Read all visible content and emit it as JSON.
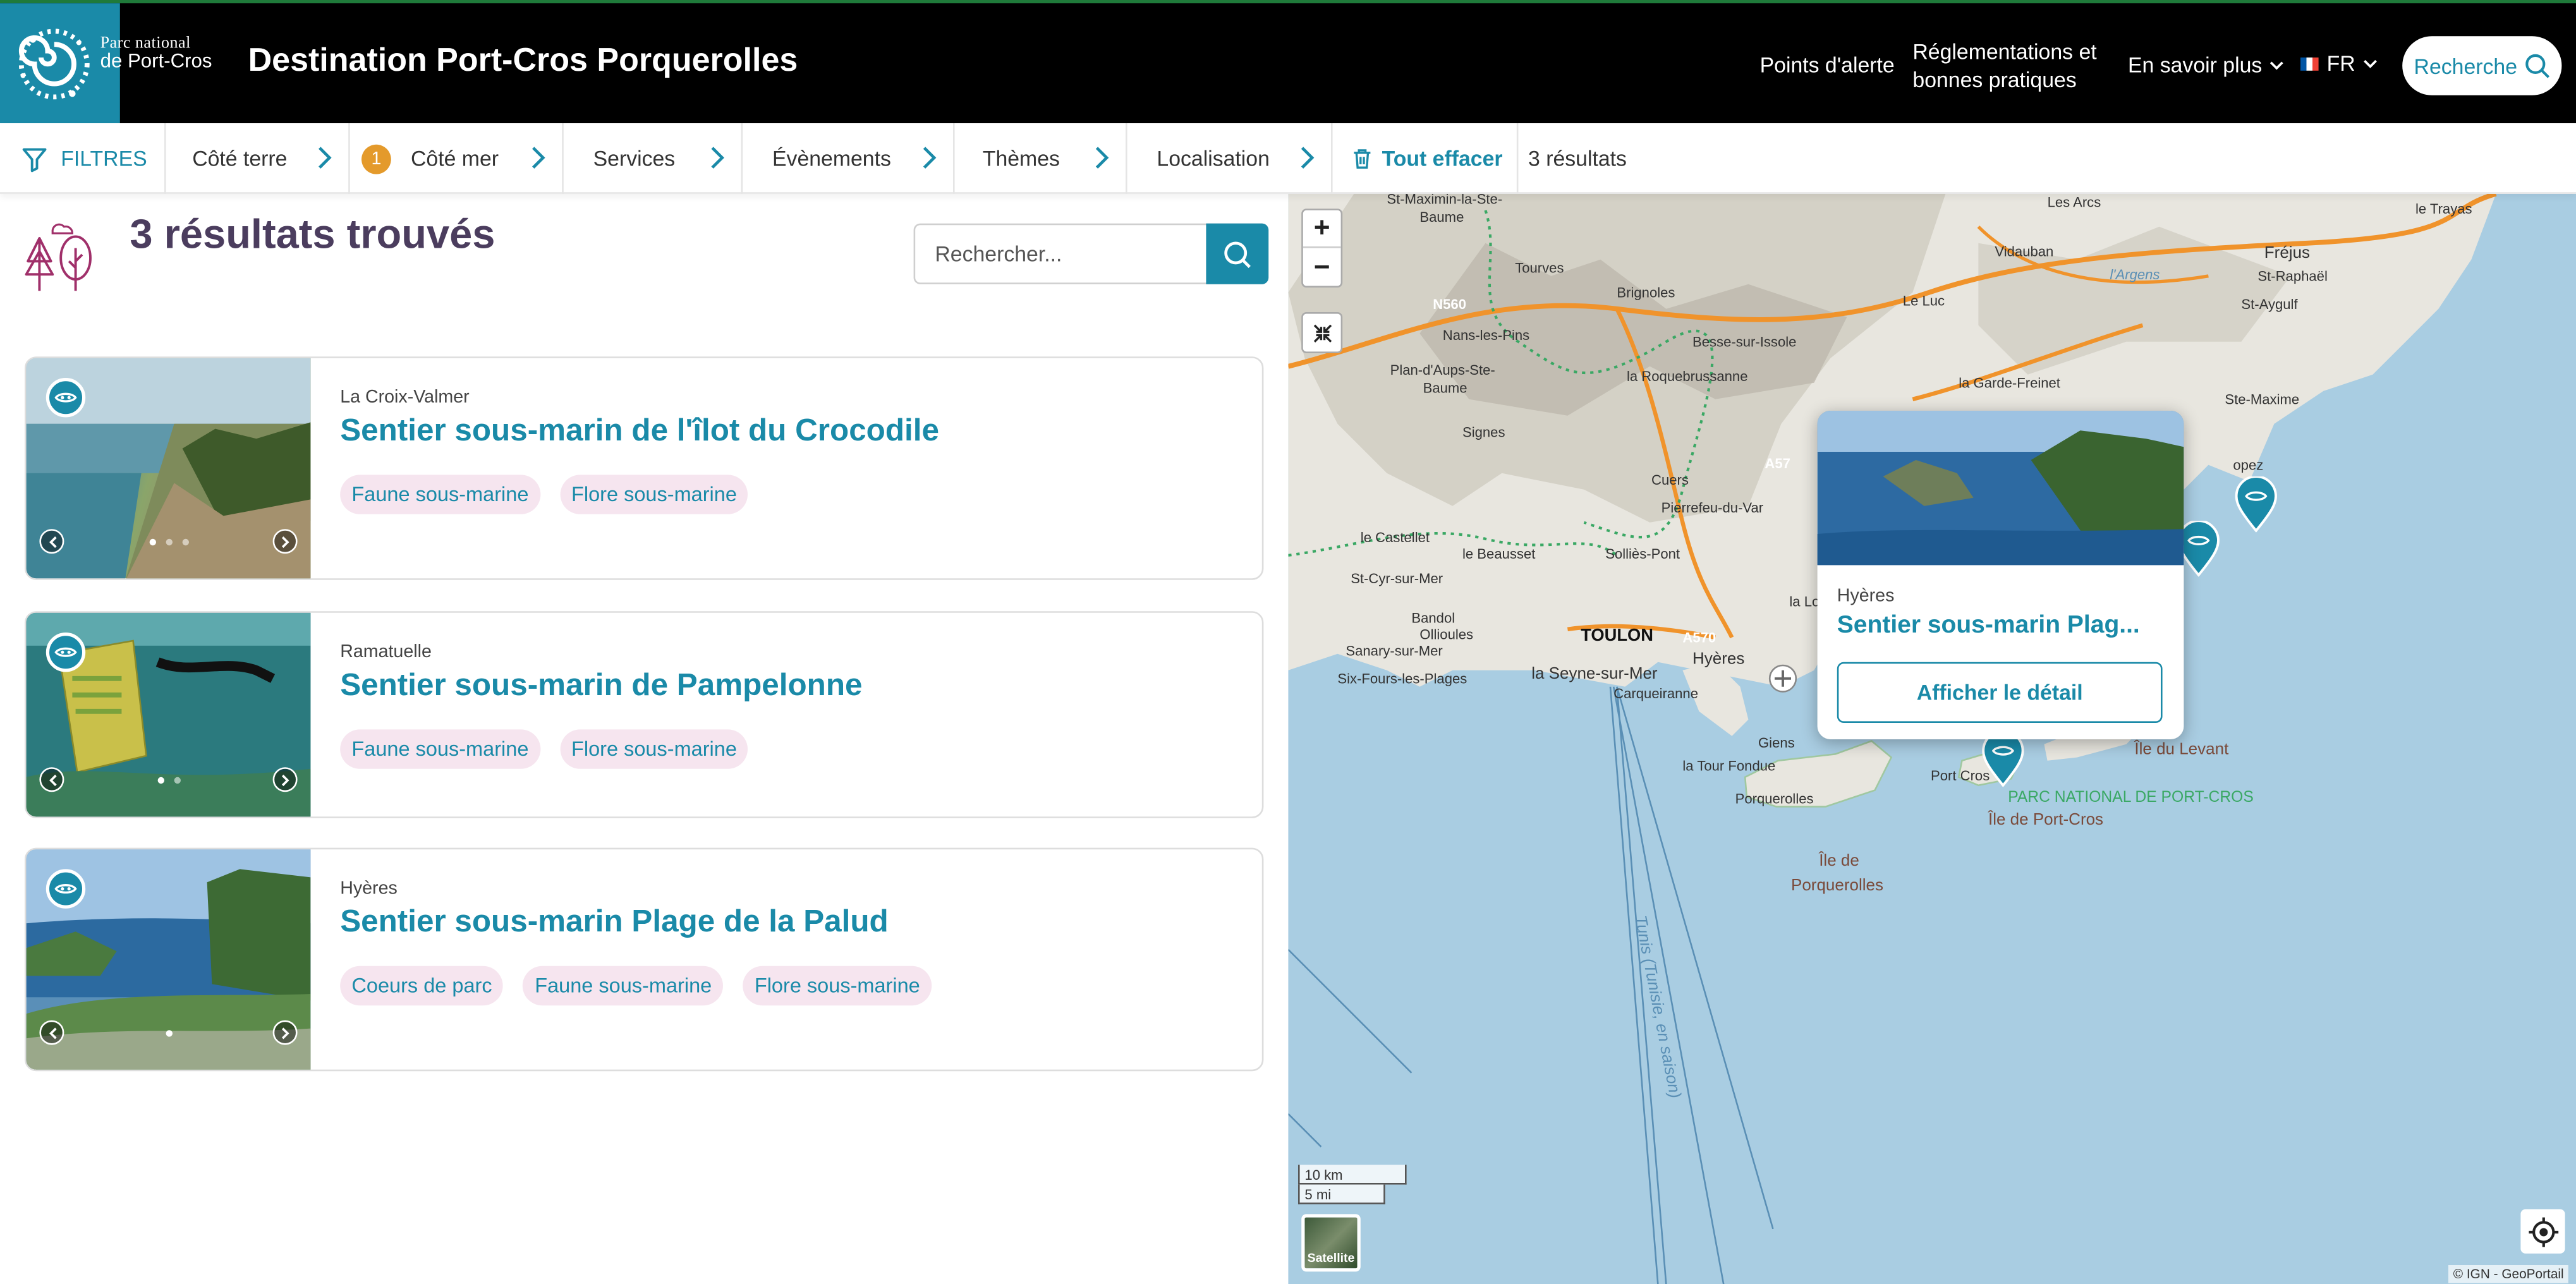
{
  "header": {
    "logo_line1": "Parc national",
    "logo_line2": "de Port-Cros",
    "site_title": "Destination Port-Cros Porquerolles",
    "nav": {
      "alert_points": "Points d'alerte",
      "regulations_line1": "Réglementations et",
      "regulations_line2": "bonnes pratiques",
      "learn_more": "En savoir plus",
      "language": "FR",
      "search": "Recherche"
    }
  },
  "filters": {
    "label": "FILTRES",
    "items": [
      "Côté terre",
      "Côté mer",
      "Services",
      "Évènements",
      "Thèmes",
      "Localisation"
    ],
    "active_count": "1",
    "clear_all": "Tout effacer",
    "results_count": "3 résultats"
  },
  "results": {
    "title": "3 résultats trouvés",
    "search_placeholder": "Rechercher...",
    "cards": [
      {
        "location": "La Croix-Valmer",
        "title": "Sentier sous-marin de l'îlot du Crocodile",
        "tags": [
          "Faune sous-marine",
          "Flore sous-marine"
        ]
      },
      {
        "location": "Ramatuelle",
        "title": "Sentier sous-marin de Pampelonne",
        "tags": [
          "Faune sous-marine",
          "Flore sous-marine"
        ]
      },
      {
        "location": "Hyères",
        "title": "Sentier sous-marin Plage de la Palud",
        "tags": [
          "Coeurs de parc",
          "Faune sous-marine",
          "Flore sous-marine"
        ]
      }
    ]
  },
  "map": {
    "popup": {
      "location": "Hyères",
      "title": "Sentier sous-marin Plag...",
      "button": "Afficher le détail"
    },
    "zoom_in": "+",
    "zoom_out": "−",
    "scale_km": "10 km",
    "scale_mi": "5 mi",
    "satellite": "Satellite",
    "attribution": "© IGN - GeoPortail",
    "labels": {
      "st_maximin": "St-Maximin-la-Ste-",
      "baume": "Baume",
      "tourves": "Tourves",
      "brignoles": "Brignoles",
      "vidauban": "Vidauban",
      "les_arcs": "Les Arcs",
      "le_trayas": "le Trayas",
      "frejus": "Fréjus",
      "st_raphael": "St-Raphaël",
      "argens": "l'Argens",
      "le_luc": "Le Luc",
      "st_aygulf": "St-Aygulf",
      "nans": "Nans-les-Pins",
      "besse": "Besse-sur-Issole",
      "plan_aups": "Plan-d'Aups-Ste-",
      "baume2": "Baume",
      "roquebrussanne": "la Roquebrussanne",
      "garde_freinet": "la Garde-Freinet",
      "ste_maxime": "Ste-Maxime",
      "signes": "Signes",
      "cuers": "Cuers",
      "pierrefeu": "Pierrefeu-du-Var",
      "castellet": "le Castellet",
      "beausset": "le Beausset",
      "sollies": "Solliès-Pont",
      "st_cyr": "St-Cyr-sur-Mer",
      "bandol": "Bandol",
      "ollioules": "Ollioules",
      "sanary": "Sanary-sur-Mer",
      "six_fours": "Six-Fours-les-Plages",
      "toulon": "TOULON",
      "seyne": "la Seyne-sur-Mer",
      "hyeres": "Hyères",
      "carqueiranne": "Carqueiranne",
      "la_londe": "la Lond",
      "giens": "Giens",
      "tour_fondue": "la Tour Fondue",
      "porquerolles": "Porquerolles",
      "ile_porquerolles1": "Île de",
      "ile_porquerolles2": "Porquerolles",
      "port_cros": "Port Cros",
      "ile_port_cros": "Île de Port-Cros",
      "parc_national": "PARC NATIONAL DE PORT-CROS",
      "ile_levant": "Île du Levant",
      "tunis": "Tunis (Tunisie, en saison)",
      "a57": "A57",
      "a570": "A570",
      "n560": "N560",
      "ramatuelle_hint": "opez"
    }
  },
  "colors": {
    "accent": "#1a8aa8",
    "header_bg": "#000000",
    "title_purple": "#4b3d5e",
    "tag_bg": "#f6e5ef",
    "badge": "#e49a2b"
  }
}
